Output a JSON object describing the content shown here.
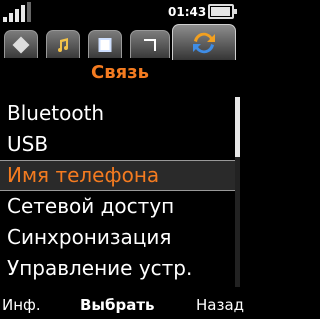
{
  "status": {
    "time": "01:43",
    "battery_level": 0.85,
    "signal_bars": 4,
    "icons": [
      "signal-icon",
      "battery-icon"
    ]
  },
  "tabs": [
    {
      "name": "settings-general-tab",
      "icon": "diamond-icon"
    },
    {
      "name": "settings-sound-tab",
      "icon": "music-note-icon"
    },
    {
      "name": "settings-display-tab",
      "icon": "display-icon"
    },
    {
      "name": "settings-calls-tab",
      "icon": "call-forward-icon"
    },
    {
      "name": "settings-connectivity-tab",
      "icon": "connectivity-icon",
      "active": true
    }
  ],
  "header": {
    "title": "Связь"
  },
  "menu": {
    "items": [
      {
        "label": "Bluetooth"
      },
      {
        "label": "USB"
      },
      {
        "label": "Имя телефона",
        "selected": true
      },
      {
        "label": "Сетевой доступ"
      },
      {
        "label": "Синхронизация"
      },
      {
        "label": "Управление устр."
      }
    ]
  },
  "softkeys": {
    "left": "Инф.",
    "middle": "Выбрать",
    "right": "Назад"
  },
  "colors": {
    "accent": "#f47b20",
    "background": "#000000",
    "text": "#ffffff"
  }
}
